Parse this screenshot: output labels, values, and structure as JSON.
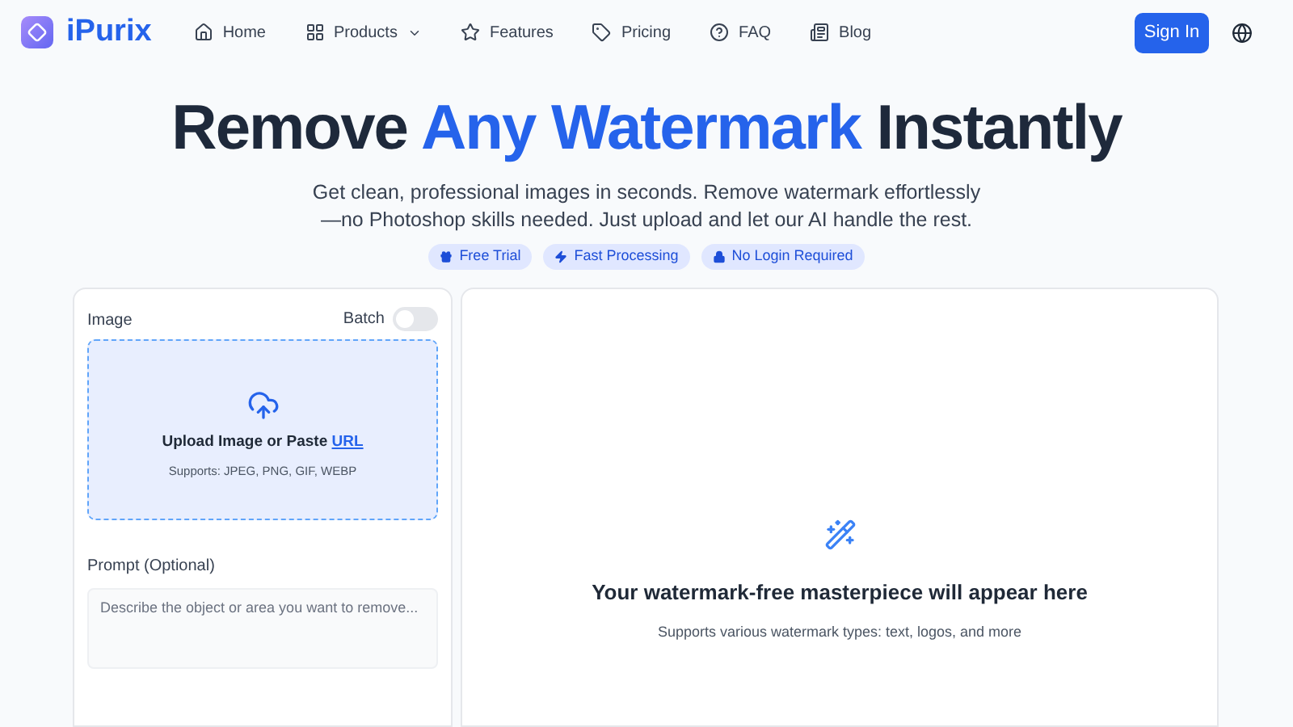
{
  "brand": {
    "name": "iPurix"
  },
  "nav": [
    {
      "label": "Home",
      "kind": "home",
      "dropdown": false
    },
    {
      "label": "Products",
      "kind": "grid",
      "dropdown": true
    },
    {
      "label": "Features",
      "kind": "star",
      "dropdown": false
    },
    {
      "label": "Pricing",
      "kind": "tag",
      "dropdown": false
    },
    {
      "label": "FAQ",
      "kind": "help",
      "dropdown": false
    },
    {
      "label": "Blog",
      "kind": "news",
      "dropdown": false
    }
  ],
  "sign_in": "Sign In",
  "hero": {
    "title": [
      {
        "text": "Remove ",
        "highlight": false
      },
      {
        "text": "Any Watermark",
        "highlight": true
      },
      {
        "text": " Instantly",
        "highlight": false
      }
    ],
    "subtitle_lines": [
      "Get clean, professional images in seconds. Remove watermark effortlessly",
      "—no Photoshop skills needed. Just upload and let our AI handle the rest."
    ],
    "badges": [
      {
        "label": "Free Trial",
        "kind": "gift"
      },
      {
        "label": "Fast Processing",
        "kind": "zap"
      },
      {
        "label": "No Login Required",
        "kind": "lock"
      }
    ]
  },
  "input_panel": {
    "image_label": "Image",
    "batch": {
      "label": "Batch",
      "on": false
    },
    "upload": {
      "text": "Upload Image or Paste ",
      "link": "URL",
      "formats": "Supports: JPEG, PNG, GIF, WEBP"
    },
    "prompt": {
      "label": "Prompt (Optional)",
      "placeholder": "Describe the object or area you want to remove..."
    }
  },
  "result_panel": {
    "title": "Your watermark-free masterpiece will appear here",
    "subtitle": "Supports various watermark types: text, logos, and more"
  }
}
